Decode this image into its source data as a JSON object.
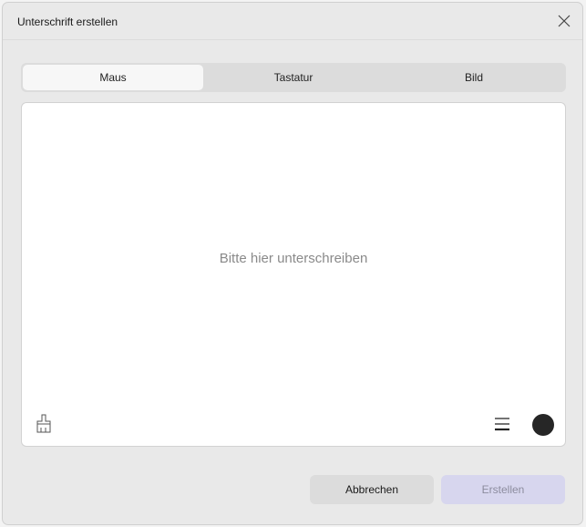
{
  "dialog": {
    "title": "Unterschrift erstellen",
    "tabs": [
      {
        "label": "Maus",
        "active": true
      },
      {
        "label": "Tastatur"
      },
      {
        "label": "Bild"
      }
    ],
    "placeholder": "Bitte hier unterschreiben",
    "pen_color": "#262626",
    "cancel_label": "Abbrechen",
    "create_label": "Erstellen"
  }
}
